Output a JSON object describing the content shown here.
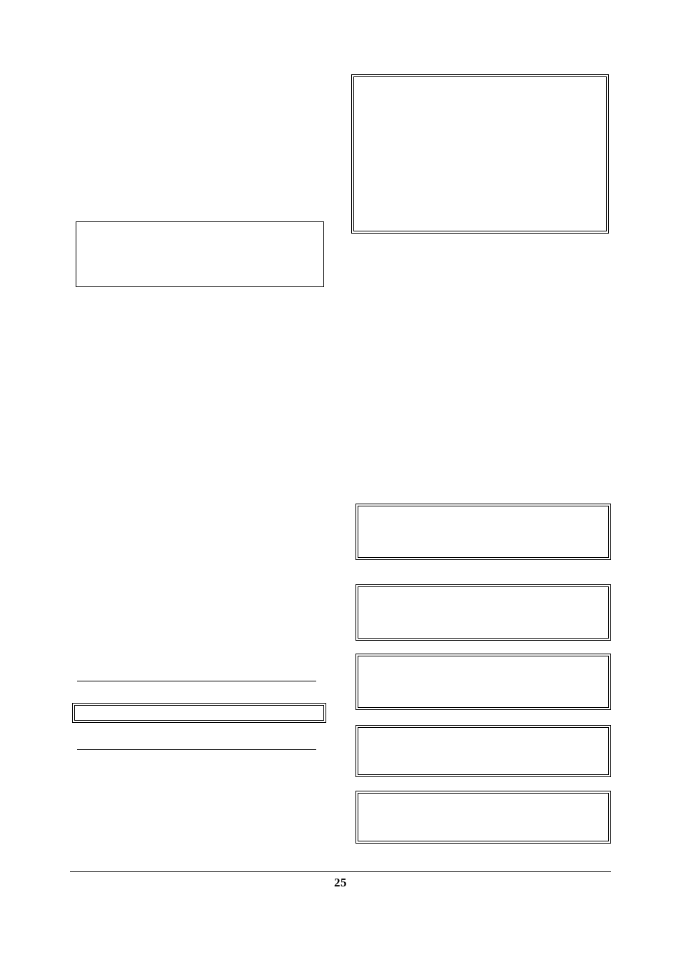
{
  "page": {
    "number": "25"
  }
}
